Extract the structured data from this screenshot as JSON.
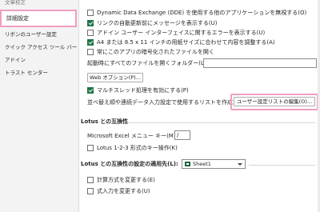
{
  "sidebar": {
    "items": [
      {
        "label": "文章校正"
      },
      {
        "label": "詳細設定"
      },
      {
        "label": "リボンのユーザー設定"
      },
      {
        "label": "クイック アクセス ツール バー"
      },
      {
        "label": "アドイン"
      },
      {
        "label": "トラスト センター"
      }
    ]
  },
  "general": {
    "dde": {
      "label": "Dynamic Data Exchange (DDE) を使用する他のアプリケーションを無視する(O)",
      "checked": false
    },
    "update_links": {
      "label": "リンクの自動更新前にメッセージを表示する(U)",
      "checked": true
    },
    "addin_errors": {
      "label": "アドイン ユーザー インターフェイスに関するエラーを表示する(U)",
      "checked": false
    },
    "a4_letter": {
      "label": "A4 または 8.5 x 11 インチの用紙サイズに合わせて内容を調整する(A)",
      "checked": true
    },
    "encrypted": {
      "label": "常にこのアプリの暗号化されたファイルを開く",
      "checked": false
    },
    "startup_label": "起動時にすべてのファイルを開くフォルダー(L):",
    "startup_value": "",
    "web_options_button": "Web オプション(P)...",
    "multithread": {
      "label": "マルチスレッド処理を有効にする(P)",
      "checked": true
    },
    "custom_lists_label": "並べ替え順や連続データ入力設定で使用するリストを作成します:",
    "custom_lists_button": "ユーザー設定リストの編集(O)..."
  },
  "lotus": {
    "title": "Lotus との互換性",
    "menu_key_label": "Microsoft Excel メニュー キー(M):",
    "menu_key_value": "/",
    "nav_keys": {
      "label": "Lotus 1-2-3 形式のキー操作(K)",
      "checked": false
    }
  },
  "lotus_sheet": {
    "title": "Lotus との互換性の設定の適用先(L):",
    "sheet_value": "Sheet1",
    "formula_eval": {
      "label": "計算方式を変更する(E)",
      "checked": false
    },
    "formula_entry": {
      "label": "式入力を変更する(U)",
      "checked": false
    }
  },
  "colors": {
    "accent": "#217346",
    "highlight": "#f19ec2"
  }
}
